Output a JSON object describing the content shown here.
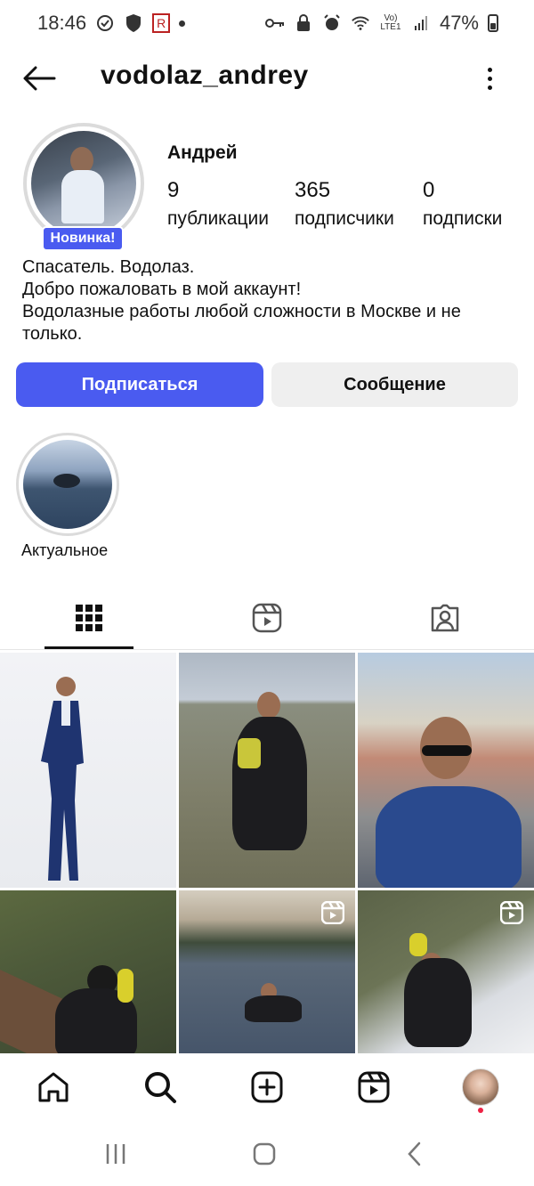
{
  "status_bar": {
    "time": "18:46",
    "battery": "47%",
    "network_label": "Vo) LTE1"
  },
  "header": {
    "username": "vodolaz_andrey"
  },
  "profile": {
    "display_name": "Андрей",
    "new_badge": "Новинка!",
    "stats": {
      "posts_count": "9",
      "posts_label": "публикации",
      "followers_count": "365",
      "followers_label": "подписчики",
      "following_count": "0",
      "following_label": "подписки"
    },
    "bio": [
      "Спасатель. Водолаз.",
      "Добро пожаловать в мой аккаунт!",
      "Водолазные работы любой сложности в Москве и не",
      "только."
    ]
  },
  "actions": {
    "follow_label": "Подписаться",
    "message_label": "Сообщение"
  },
  "highlights": [
    {
      "label": "Актуальное"
    }
  ],
  "tabs": [
    {
      "icon": "grid-icon",
      "selected": true
    },
    {
      "icon": "reels-icon",
      "selected": false
    },
    {
      "icon": "tagged-icon",
      "selected": false
    }
  ],
  "grid_posts": [
    {
      "subject": "man in blue suit",
      "is_reel": false
    },
    {
      "subject": "diver standing in lake",
      "is_reel": false
    },
    {
      "subject": "man with sunglasses on street",
      "is_reel": false
    },
    {
      "subject": "diver at pier",
      "is_reel": false
    },
    {
      "subject": "diver swimming in lake",
      "is_reel": true
    },
    {
      "subject": "diver on snowy bank",
      "is_reel": true
    }
  ],
  "bottom_nav": [
    "home-icon",
    "search-icon",
    "create-icon",
    "reels-icon",
    "profile-avatar"
  ],
  "colors": {
    "accent": "#4a5bf0",
    "secondary_button": "#efefef",
    "notification_dot": "#ee2244"
  }
}
